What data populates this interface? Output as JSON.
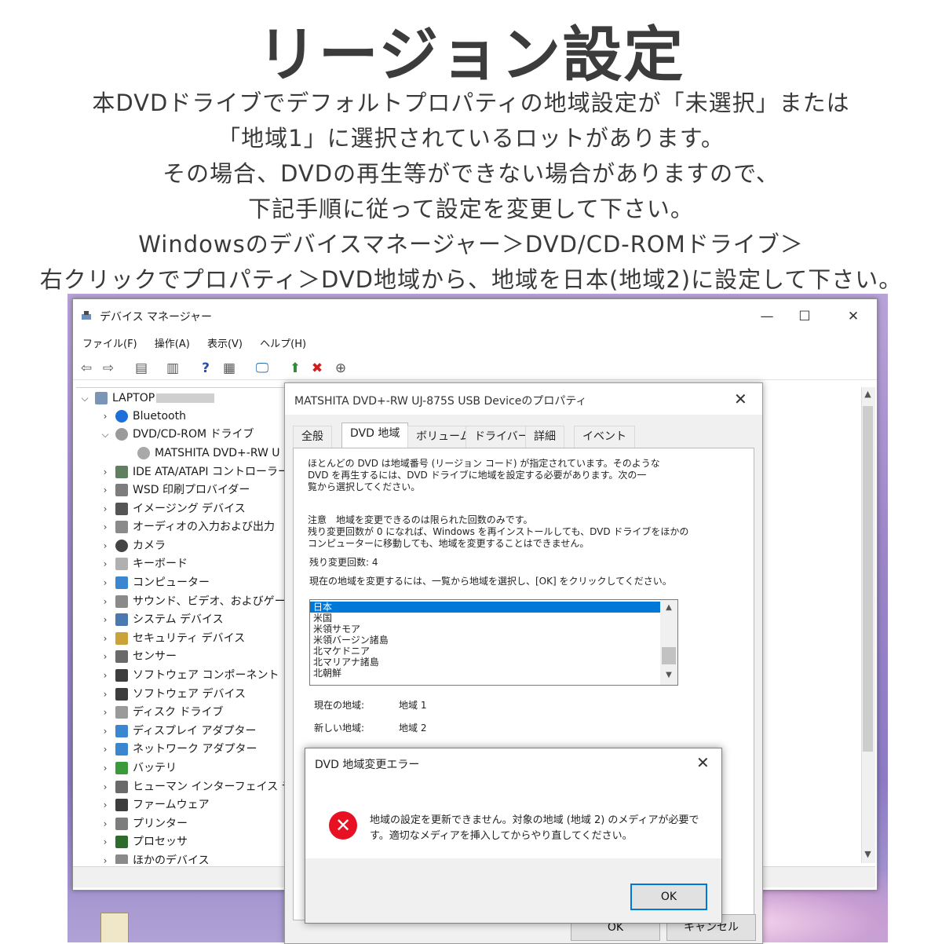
{
  "header": {
    "title": "リージョン設定",
    "lines": [
      "本DVDドライブでデフォルトプロパティの地域設定が「未選択」または",
      "「地域1」に選択されているロットがあります。",
      "その場合、DVDの再生等ができない場合がありますので、",
      "下記手順に従って設定を変更して下さい。",
      "Windowsのデバイスマネージャー＞DVD/CD-ROMドライブ＞",
      "右クリックでプロパティ＞DVD地域から、地域を日本(地域2)に設定して下さい。"
    ]
  },
  "device_manager": {
    "title": "デバイス マネージャー",
    "window_controls": {
      "minimize": "—",
      "maximize": "☐",
      "close": "✕"
    },
    "menu": [
      "ファイル(F)",
      "操作(A)",
      "表示(V)",
      "ヘルプ(H)"
    ],
    "toolbar_icons": [
      "back-arrow-icon",
      "forward-arrow-icon",
      "properties-icon",
      "document-icon",
      "help-icon",
      "view-icon",
      "monitor-scan-icon",
      "add-driver-icon",
      "remove-icon",
      "download-icon"
    ],
    "tree": {
      "root": "LAPTOP",
      "items": [
        {
          "label": "Bluetooth",
          "expanded": false
        },
        {
          "label": "DVD/CD-ROM ドライブ",
          "expanded": true
        },
        {
          "label": "MATSHITA DVD+-RW U",
          "child": true
        },
        {
          "label": "IDE ATA/ATAPI コントローラー",
          "expanded": false
        },
        {
          "label": "WSD 印刷プロバイダー",
          "expanded": false
        },
        {
          "label": "イメージング デバイス",
          "expanded": false
        },
        {
          "label": "オーディオの入力および出力",
          "expanded": false
        },
        {
          "label": "カメラ",
          "expanded": false
        },
        {
          "label": "キーボード",
          "expanded": false
        },
        {
          "label": "コンピューター",
          "expanded": false
        },
        {
          "label": "サウンド、ビデオ、およびゲーム コ",
          "expanded": false
        },
        {
          "label": "システム デバイス",
          "expanded": false
        },
        {
          "label": "セキュリティ デバイス",
          "expanded": false
        },
        {
          "label": "センサー",
          "expanded": false
        },
        {
          "label": "ソフトウェア コンポーネント",
          "expanded": false
        },
        {
          "label": "ソフトウェア デバイス",
          "expanded": false
        },
        {
          "label": "ディスク ドライブ",
          "expanded": false
        },
        {
          "label": "ディスプレイ アダプター",
          "expanded": false
        },
        {
          "label": "ネットワーク アダプター",
          "expanded": false
        },
        {
          "label": "バッテリ",
          "expanded": false
        },
        {
          "label": "ヒューマン インターフェイス デバイス",
          "expanded": false
        },
        {
          "label": "ファームウェア",
          "expanded": false
        },
        {
          "label": "プリンター",
          "expanded": false
        },
        {
          "label": "プロセッサ",
          "expanded": false
        },
        {
          "label": "ほかのデバイス",
          "expanded": false
        }
      ]
    }
  },
  "properties": {
    "title": "MATSHITA DVD+-RW UJ-875S USB Deviceのプロパティ",
    "tabs": [
      "全般",
      "DVD 地域",
      "ボリューム",
      "ドライバー",
      "詳細",
      "イベント"
    ],
    "active_tab": "DVD 地域",
    "intro_lines": [
      "ほとんどの DVD は地域番号 (リージョン コード) が指定されています。そのような",
      "DVD を再生するには、DVD ドライブに地域を設定する必要があります。次の一",
      "覧から選択してください。"
    ],
    "caution_lines": [
      "注意　地域を変更できるのは限られた回数のみです。",
      "残り変更回数が 0 になれば、Windows を再インストールしても、DVD ドライブをほかの",
      "コンピューターに移動しても、地域を変更することはできません。"
    ],
    "remaining_label": "残り変更回数: 4",
    "instruction": "現在の地域を変更するには、一覧から地域を選択し、[OK] をクリックしてください。",
    "regions": [
      "日本",
      "米国",
      "米領サモア",
      "米領バージン諸島",
      "北マケドニア",
      "北マリアナ諸島",
      "北朝鮮"
    ],
    "selected_region": "日本",
    "current_region_label": "現在の地域:",
    "current_region_value": "地域 1",
    "new_region_label": "新しい地域:",
    "new_region_value": "地域 2",
    "ok_label": "OK",
    "cancel_label": "キャンセル"
  },
  "error_dialog": {
    "title": "DVD 地域変更エラー",
    "close": "✕",
    "message_lines": [
      "地域の設定を更新できません。対象の地域 (地域 2) のメディアが必要で",
      "す。適切なメディアを挿入してからやり直してください。"
    ],
    "ok_label": "OK"
  },
  "colors": {
    "selection": "#0078d7",
    "error_red": "#e81123",
    "desktop_purple": "#9c86c9"
  }
}
